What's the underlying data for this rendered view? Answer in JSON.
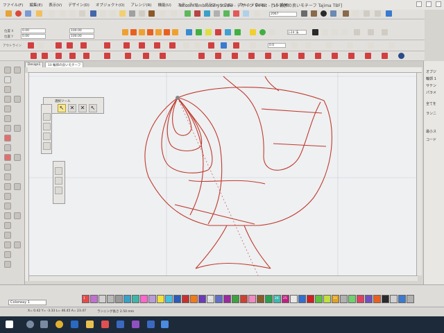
{
  "window": {
    "title": "Wilcom EmbroideryStudio - デザイン 64-bit - [10 輪郭の良いモチーフ   Tajima TBF]"
  },
  "menu": [
    "ファイル(F)",
    "編集(E)",
    "表示(V)",
    "デザイン(D)",
    "オブジェクト(O)",
    "アレンジ(R)",
    "機能(U)",
    "ステッチ(S)",
    "グラフィック(G)",
    "ウィンドウ(W)",
    "ヘルプ(H)"
  ],
  "property_bar": {
    "labels": [
      "位置 X",
      "位置 Y"
    ],
    "values": [
      "0.00",
      "0.00",
      "100.00",
      "100.00"
    ],
    "number_field": "2067",
    "font_field": "J-24 法"
  },
  "stitch_bar": {
    "label": "アウトライン",
    "field_value": "0.0"
  },
  "tabs": [
    {
      "label": "Design1",
      "active": false
    },
    {
      "label": "10 輪郭の良いモチーフ",
      "active": true
    }
  ],
  "floating_toolbox": {
    "title": "選択ツール"
  },
  "right_panel": {
    "lines": [
      "オブジ",
      "輪郭 1",
      "サテン",
      "パラメ",
      "全てを",
      "ランニ",
      "最小ス",
      "コード"
    ]
  },
  "palette": {
    "colorway": "Colorway 1",
    "swatch_labels": [
      "1",
      "16",
      "24",
      "25",
      "31"
    ],
    "swatches": [
      "#e64a4a",
      "#c070d0",
      "#d0d0d0",
      "#b8b8b8",
      "#9a9a9a",
      "#39a0c8",
      "#3fb5a8",
      "#ff66cc",
      "#b89bd8",
      "#f0e040",
      "#47c0e0",
      "#2e5ab8",
      "#c83030",
      "#f07a1a",
      "#6c3ab8",
      "#d9d9d9",
      "#6070c8",
      "#9a2aa0",
      "#40a040",
      "#d04030",
      "#f08ac0",
      "#8a5a2a",
      "#2aa050",
      "#40b8b0",
      "#c02080",
      "#e8e8e8",
      "#3070d0",
      "#d02020",
      "#60c040",
      "#c0e040",
      "#e0a020",
      "#b0b0b0",
      "#70d070",
      "#e04060",
      "#7050c0",
      "#e86020",
      "#2a2a2a",
      "#d0d0d0",
      "#3a7ad0",
      "#b0b0b0"
    ]
  },
  "status": {
    "coords": "X= 0.42  Y= -3.33  L= 46.45  A= 23.47",
    "stitch_info": "ランニング長さ 2.50 mm"
  },
  "colors": {
    "outline": "#c0392b",
    "canvas": "#eef0f2",
    "taskbar": "#1d2a3a"
  }
}
